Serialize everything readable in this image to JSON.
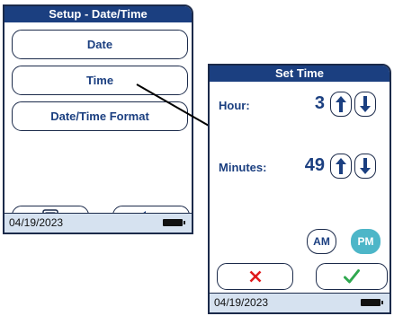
{
  "setup_screen": {
    "title": "Setup - Date/Time",
    "buttons": [
      {
        "label": "Date"
      },
      {
        "label": "Time"
      },
      {
        "label": "Date/Time Format"
      }
    ],
    "bottom_buttons": {
      "menu_icon": "list-icon",
      "back_icon": "left-arrow-icon"
    },
    "status_date": "04/19/2023"
  },
  "time_screen": {
    "title": "Set Time",
    "hour_label": "Hour:",
    "hour_value": "3",
    "minutes_label": "Minutes:",
    "minutes_value": "49",
    "am_label": "AM",
    "pm_label": "PM",
    "selected_period": "PM",
    "cancel_icon": "x-icon",
    "confirm_icon": "check-icon",
    "status_date": "04/19/2023"
  },
  "colors": {
    "title_bg": "#1b3f80",
    "accent_text": "#1b3f80",
    "pm_selected_bg": "#4db6c8",
    "cancel": "#e0191b",
    "confirm": "#2fa84f",
    "status_bg": "#d6e2f0"
  }
}
